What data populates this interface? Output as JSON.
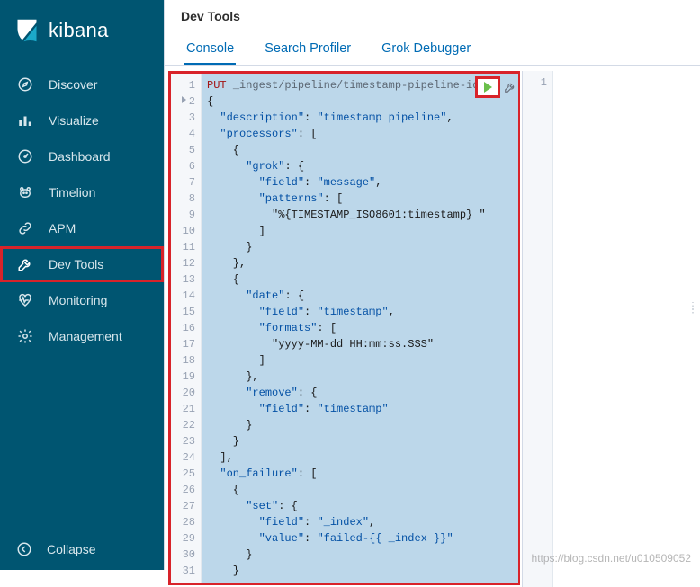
{
  "brand": {
    "name": "kibana"
  },
  "sidebar": {
    "items": [
      {
        "label": "Discover",
        "icon": "compass-icon"
      },
      {
        "label": "Visualize",
        "icon": "bar-chart-icon"
      },
      {
        "label": "Dashboard",
        "icon": "gauge-icon"
      },
      {
        "label": "Timelion",
        "icon": "bear-icon"
      },
      {
        "label": "APM",
        "icon": "link-icon"
      },
      {
        "label": "Dev Tools",
        "icon": "wrench-icon"
      },
      {
        "label": "Monitoring",
        "icon": "heartbeat-icon"
      },
      {
        "label": "Management",
        "icon": "gear-icon"
      }
    ],
    "collapse_label": "Collapse"
  },
  "header": {
    "title": "Dev Tools"
  },
  "tabs": {
    "items": [
      {
        "label": "Console"
      },
      {
        "label": "Search Profiler"
      },
      {
        "label": "Grok Debugger"
      }
    ],
    "active_index": 0
  },
  "editor": {
    "request_method": "PUT",
    "request_path": "_ingest/pipeline/timestamp-pipeline-id",
    "body_lines": [
      "{",
      "  \"description\": \"timestamp pipeline\",",
      "  \"processors\": [",
      "    {",
      "      \"grok\": {",
      "        \"field\": \"message\",",
      "        \"patterns\": [",
      "          \"%{TIMESTAMP_ISO8601:timestamp} \"",
      "        ]",
      "      }",
      "    },",
      "    {",
      "      \"date\": {",
      "        \"field\": \"timestamp\",",
      "        \"formats\": [",
      "          \"yyyy-MM-dd HH:mm:ss.SSS\"",
      "        ]",
      "      },",
      "      \"remove\": {",
      "        \"field\": \"timestamp\"",
      "      }",
      "    }",
      "  ],",
      "  \"on_failure\": [",
      "    {",
      "      \"set\": {",
      "        \"field\": \"_index\",",
      "        \"value\": \"failed-{{ _index }}\"",
      "      }",
      "    }"
    ],
    "first_line_number": 1
  },
  "result": {
    "first_line_number": 1
  },
  "watermark": "https://blog.csdn.net/u010509052"
}
